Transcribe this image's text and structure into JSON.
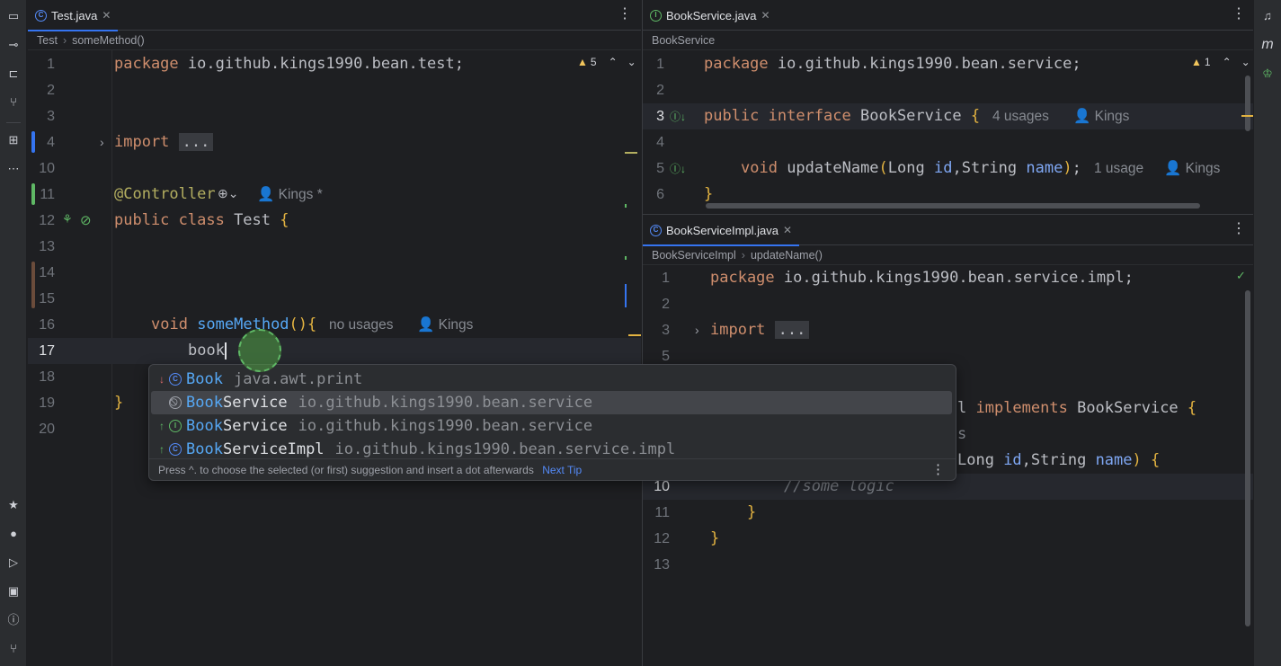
{
  "left_editor": {
    "tab": {
      "label": "Test.java",
      "icon": "class-c-icon"
    },
    "breadcrumb": [
      "Test",
      "someMethod()"
    ],
    "warnings": "5",
    "lines": [
      {
        "n": "1",
        "text": "package io.github.kings1990.bean.test;"
      },
      {
        "n": "2",
        "text": ""
      },
      {
        "n": "3",
        "text": ""
      },
      {
        "n": "4",
        "text": "import ..."
      },
      {
        "n": "10",
        "text": ""
      },
      {
        "n": "11",
        "text": "@Controller",
        "hint": "Kings *"
      },
      {
        "n": "12",
        "text": "public class Test {"
      },
      {
        "n": "13",
        "text": ""
      },
      {
        "n": "14",
        "text": ""
      },
      {
        "n": "15",
        "text": ""
      },
      {
        "n": "16",
        "text": "void someMethod(){",
        "hint1": "no usages",
        "hint2": "Kings"
      },
      {
        "n": "17",
        "text": "book"
      },
      {
        "n": "18",
        "text": ""
      },
      {
        "n": "19",
        "text": "}"
      },
      {
        "n": "20",
        "text": ""
      }
    ]
  },
  "top_right_editor": {
    "tab": {
      "label": "BookService.java",
      "icon": "interface-i-icon"
    },
    "breadcrumb": [
      "BookService"
    ],
    "warnings": "1",
    "lines": [
      {
        "n": "1",
        "text": "package io.github.kings1990.bean.service;"
      },
      {
        "n": "2",
        "text": ""
      },
      {
        "n": "3",
        "text": "public interface BookService {",
        "hint1": "4 usages",
        "hint2": "Kings"
      },
      {
        "n": "4",
        "text": ""
      },
      {
        "n": "5",
        "text": "void updateName(Long id,String name);",
        "hint1": "1 usage",
        "hint2": "Kings"
      },
      {
        "n": "6",
        "text": "}"
      }
    ]
  },
  "bottom_right_editor": {
    "tab": {
      "label": "BookServiceImpl.java",
      "icon": "class-c-icon"
    },
    "breadcrumb": [
      "BookServiceImpl",
      "updateName()"
    ],
    "lines": [
      {
        "n": "1",
        "text": "package io.github.kings1990.bean.service.impl;"
      },
      {
        "n": "2",
        "text": ""
      },
      {
        "n": "3",
        "text": "import ..."
      },
      {
        "n": "5",
        "text": ""
      },
      {
        "n": "",
        "text": "l implements BookService {"
      },
      {
        "n": "",
        "text": "s"
      },
      {
        "n": "",
        "text": "Long id,String name) {"
      },
      {
        "n": "10",
        "text": "//some logic"
      },
      {
        "n": "11",
        "text": "}"
      },
      {
        "n": "12",
        "text": "}"
      },
      {
        "n": "13",
        "text": ""
      }
    ]
  },
  "completion": {
    "items": [
      {
        "match": "Book",
        "rest": "",
        "pkg": "java.awt.print",
        "icon": "class-c-icon",
        "arrow": "↓"
      },
      {
        "match": "Book",
        "rest": "Service",
        "pkg": "io.github.kings1990.bean.service",
        "icon": "deprecated-icon",
        "arrow": ""
      },
      {
        "match": "Book",
        "rest": "Service",
        "pkg": "io.github.kings1990.bean.service",
        "icon": "interface-i-icon",
        "arrow": "↑"
      },
      {
        "match": "Book",
        "rest": "ServiceImpl",
        "pkg": "io.github.kings1990.bean.service.impl",
        "icon": "class-c-icon",
        "arrow": "↑"
      }
    ],
    "footer_text": "Press ^. to choose the selected (or first) suggestion and insert a dot afterwards",
    "footer_link": "Next Tip"
  },
  "right_strip": {
    "maven_label": "m"
  }
}
